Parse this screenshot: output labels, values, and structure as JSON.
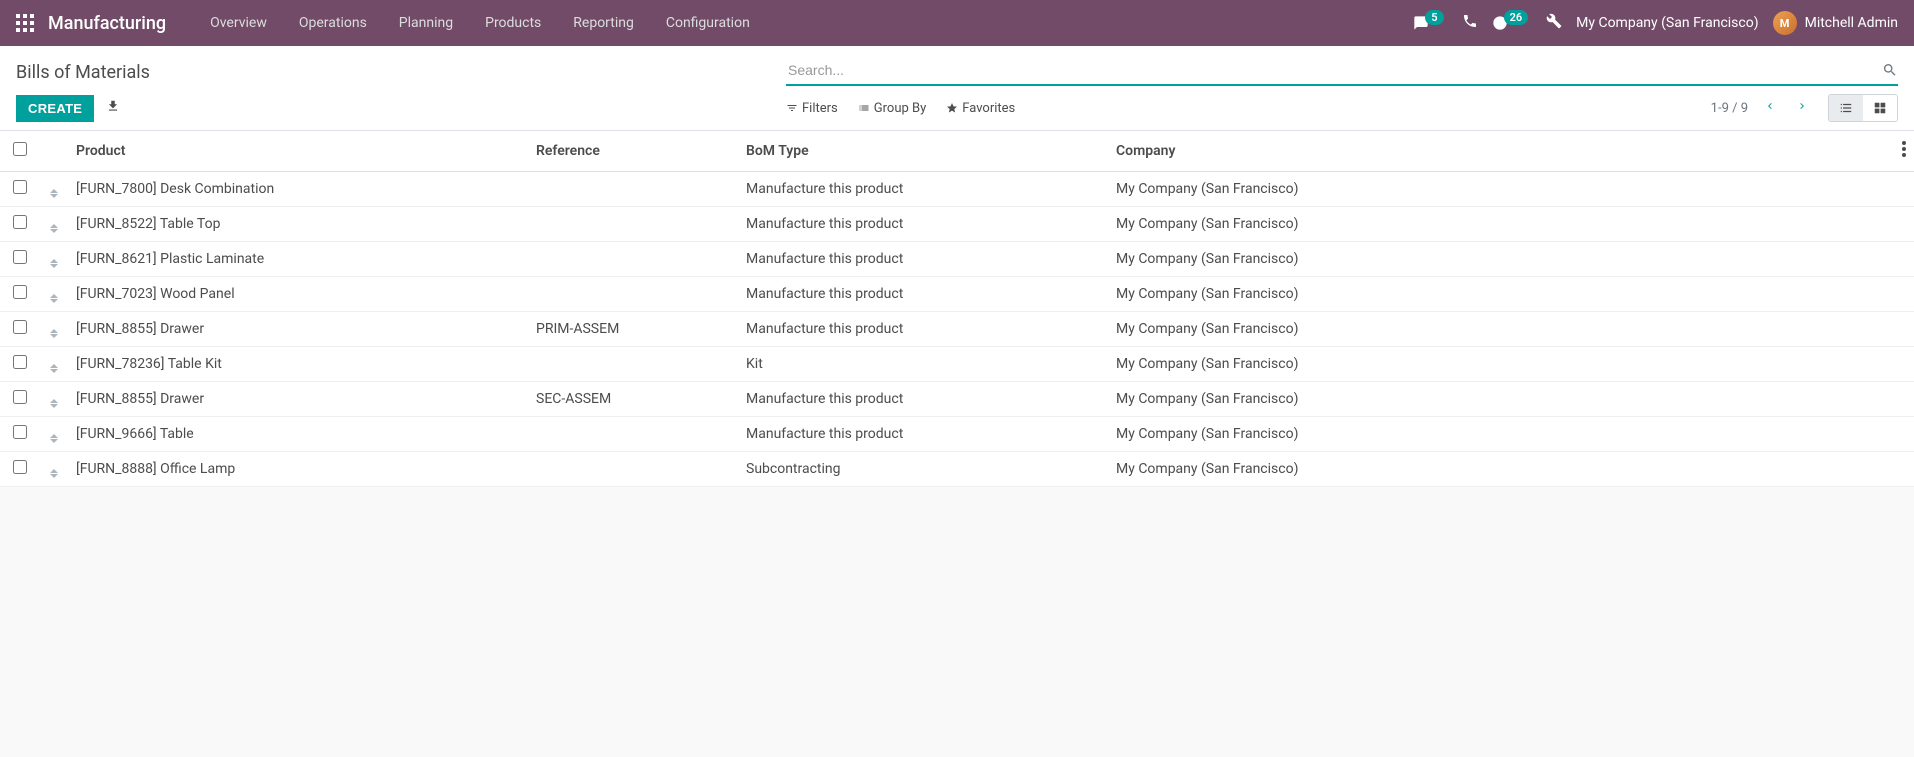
{
  "navbar": {
    "app_name": "Manufacturing",
    "menu": [
      "Overview",
      "Operations",
      "Planning",
      "Products",
      "Reporting",
      "Configuration"
    ],
    "messages_badge": "5",
    "activities_badge": "26",
    "company": "My Company (San Francisco)",
    "user_name": "Mitchell Admin"
  },
  "control_panel": {
    "title": "Bills of Materials",
    "search_placeholder": "Search...",
    "create_label": "CREATE",
    "filters_label": "Filters",
    "groupby_label": "Group By",
    "favorites_label": "Favorites",
    "pager": "1-9 / 9"
  },
  "table": {
    "headers": {
      "product": "Product",
      "reference": "Reference",
      "bom_type": "BoM Type",
      "company": "Company"
    },
    "rows": [
      {
        "product": "[FURN_7800] Desk Combination",
        "reference": "",
        "bom_type": "Manufacture this product",
        "company": "My Company (San Francisco)"
      },
      {
        "product": "[FURN_8522] Table Top",
        "reference": "",
        "bom_type": "Manufacture this product",
        "company": "My Company (San Francisco)"
      },
      {
        "product": "[FURN_8621] Plastic Laminate",
        "reference": "",
        "bom_type": "Manufacture this product",
        "company": "My Company (San Francisco)"
      },
      {
        "product": "[FURN_7023] Wood Panel",
        "reference": "",
        "bom_type": "Manufacture this product",
        "company": "My Company (San Francisco)"
      },
      {
        "product": "[FURN_8855] Drawer",
        "reference": "PRIM-ASSEM",
        "bom_type": "Manufacture this product",
        "company": "My Company (San Francisco)"
      },
      {
        "product": "[FURN_78236] Table Kit",
        "reference": "",
        "bom_type": "Kit",
        "company": "My Company (San Francisco)"
      },
      {
        "product": "[FURN_8855] Drawer",
        "reference": "SEC-ASSEM",
        "bom_type": "Manufacture this product",
        "company": "My Company (San Francisco)"
      },
      {
        "product": "[FURN_9666] Table",
        "reference": "",
        "bom_type": "Manufacture this product",
        "company": "My Company (San Francisco)"
      },
      {
        "product": "[FURN_8888] Office Lamp",
        "reference": "",
        "bom_type": "Subcontracting",
        "company": "My Company (San Francisco)"
      }
    ]
  }
}
